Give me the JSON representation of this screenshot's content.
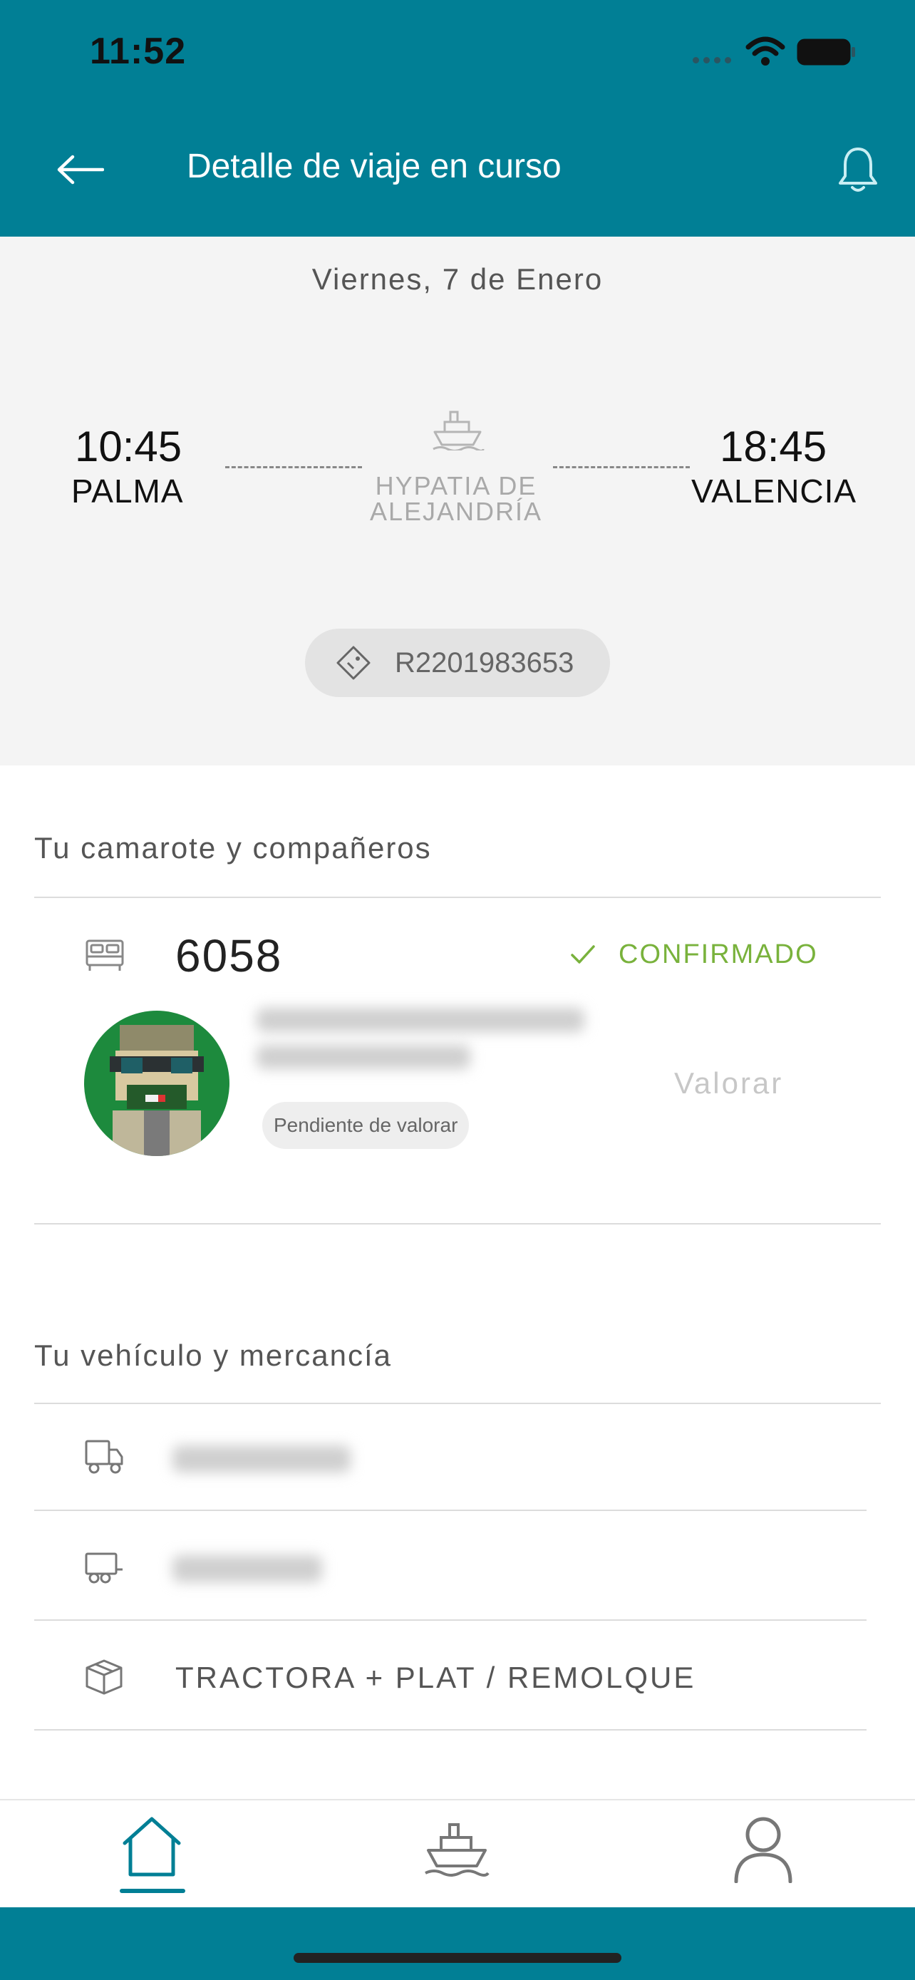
{
  "status_bar": {
    "time": "11:52"
  },
  "header": {
    "title": "Detalle de viaje en curso",
    "icons": [
      "arrow-left-icon",
      "bell-icon"
    ]
  },
  "trip": {
    "date": "Viernes, 7 de Enero",
    "departure": {
      "time": "10:45",
      "city": "PALMA"
    },
    "arrival": {
      "time": "18:45",
      "city": "VALENCIA"
    },
    "ship_line1": "HYPATIA DE",
    "ship_line2": "ALEJANDRÍA",
    "booking_code": "R2201983653"
  },
  "cabin_section": {
    "title": "Tu camarote y compañeros",
    "cabin_number": "6058",
    "status": "CONFIRMADO",
    "status_color": "#79b23c",
    "companion": {
      "badge": "Pendiente de valorar",
      "action": "Valorar"
    }
  },
  "vehicle_section": {
    "title": "Tu vehículo y mercancía",
    "rows": [
      {
        "icon": "truck-icon",
        "value": ""
      },
      {
        "icon": "trailer-icon",
        "value": ""
      },
      {
        "icon": "package-icon",
        "value": "TRACTORA + PLAT / REMOLQUE"
      }
    ]
  },
  "tabs": [
    {
      "icon": "home-icon",
      "active": true
    },
    {
      "icon": "ship-icon",
      "active": false
    },
    {
      "icon": "user-icon",
      "active": false
    }
  ],
  "colors": {
    "brand": "#017f95",
    "background": "#f4f4f4",
    "confirmed": "#79b23c"
  }
}
